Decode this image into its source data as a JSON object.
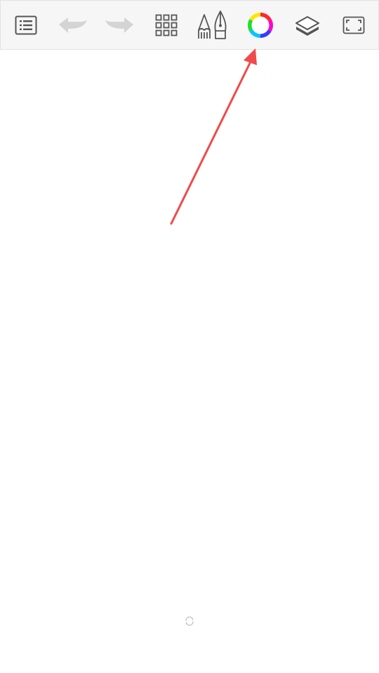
{
  "toolbar": {
    "buttons": [
      {
        "icon": "list-icon",
        "state": "enabled"
      },
      {
        "icon": "undo-icon",
        "state": "disabled"
      },
      {
        "icon": "redo-icon",
        "state": "disabled"
      },
      {
        "icon": "grid-icon",
        "state": "enabled"
      },
      {
        "icon": "pencil-pen-icon",
        "state": "enabled"
      },
      {
        "icon": "color-wheel-icon",
        "state": "enabled"
      },
      {
        "icon": "layers-icon",
        "state": "enabled"
      },
      {
        "icon": "fullscreen-icon",
        "state": "enabled"
      }
    ]
  },
  "annotation": {
    "type": "arrow",
    "points_to": "color-wheel-button",
    "color": "#f04a4a"
  },
  "canvas": {
    "loading_icon": "refresh-icon"
  },
  "colors": {
    "toolbar_bg": "#f6f6f6",
    "icon": "#555555",
    "icon_disabled": "#d4d4d4",
    "arrow": "#f04a4a"
  }
}
